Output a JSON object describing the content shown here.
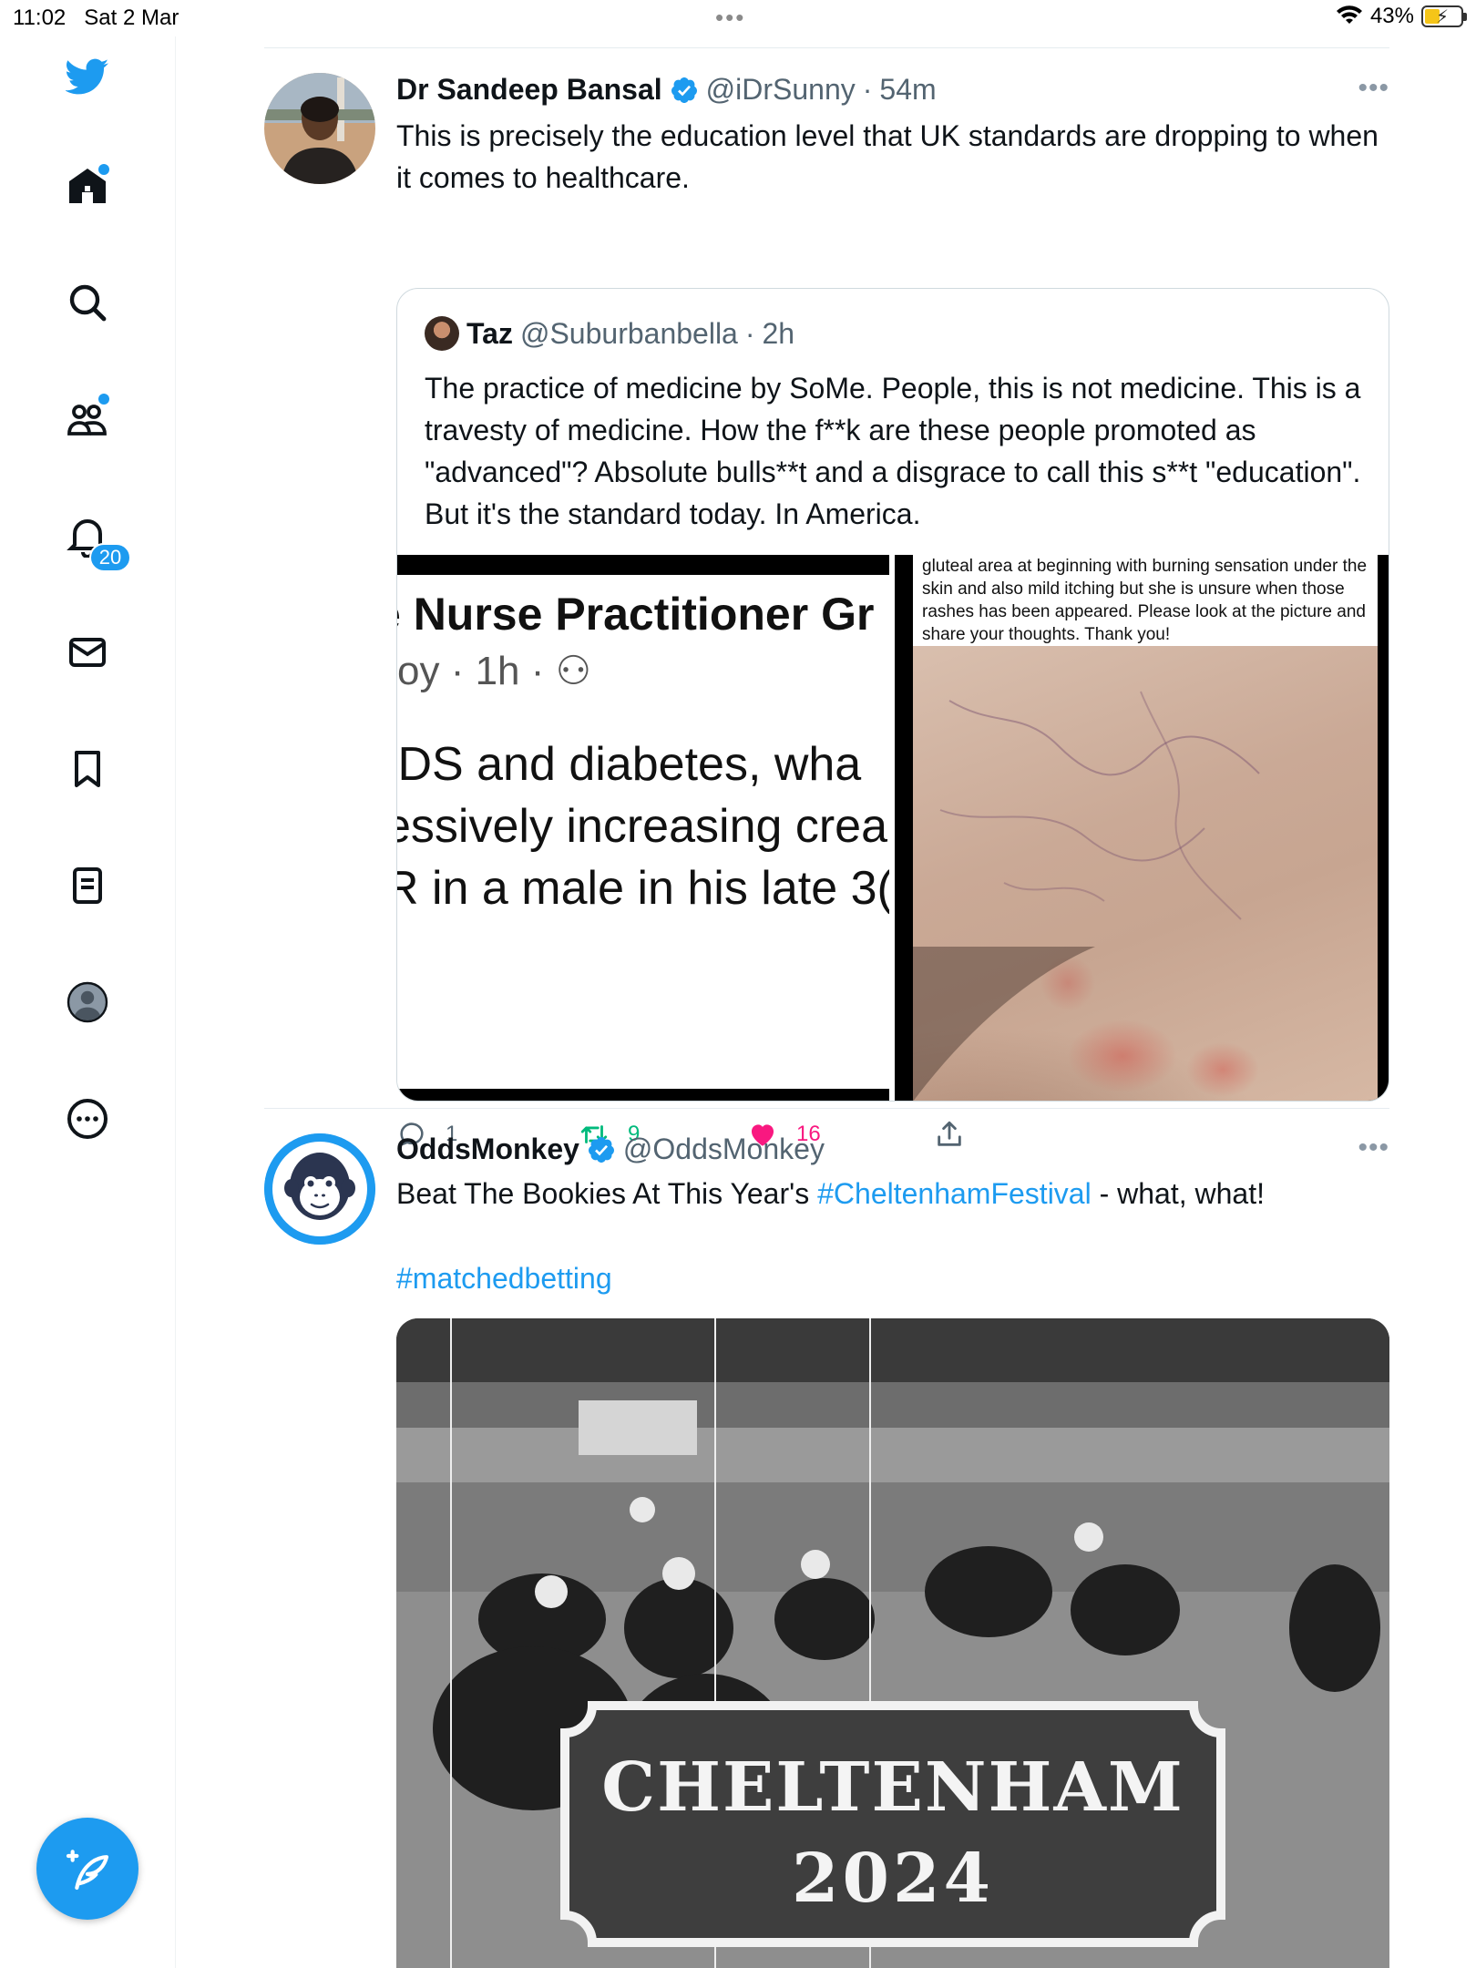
{
  "status_bar": {
    "time": "11:02",
    "date": "Sat 2 Mar",
    "battery": "43%",
    "battery_level": 0.43
  },
  "sidebar": {
    "items": [
      {
        "name": "twitter-logo",
        "icon": "bird-icon"
      },
      {
        "name": "home",
        "icon": "home-icon",
        "has_dot": true
      },
      {
        "name": "explore",
        "icon": "search-icon"
      },
      {
        "name": "communities",
        "icon": "people-icon",
        "has_dot": true
      },
      {
        "name": "notifications",
        "icon": "bell-icon",
        "badge": "20"
      },
      {
        "name": "messages",
        "icon": "mail-icon"
      },
      {
        "name": "bookmarks",
        "icon": "bookmark-icon"
      },
      {
        "name": "lists",
        "icon": "list-icon"
      },
      {
        "name": "profile",
        "icon": "profile-avatar-icon"
      },
      {
        "name": "more",
        "icon": "more-circle-icon"
      }
    ],
    "notifications_badge": "20",
    "compose_icon": "compose-feather-icon"
  },
  "colors": {
    "accent": "#1d9bf0",
    "like": "#f91880",
    "retweet": "#00ba7c",
    "text": "#0f1419",
    "muted": "#536471"
  },
  "tweets": [
    {
      "author": "Dr Sandeep Bansal",
      "handle": "@iDrSunny",
      "separator": "·",
      "time": "54m",
      "verified": true,
      "more": "•••",
      "text": "This is precisely the education level that UK standards are dropping to when it comes to healthcare.",
      "quote": {
        "author": "Taz",
        "handle": "@Suburbanbella",
        "separator": "·",
        "time": "2h",
        "text": "The practice of medicine by SoMe. People, this is not medicine. This is a travesty of medicine. How the f**k are these people promoted as \"advanced\"? Absolute bulls**t and a disgrace to call this s**t \"education\". But it's the standard today. In America.",
        "image_left": {
          "title": "e Nurse Practitioner Gr",
          "meta": "oy · 1h · ⚇",
          "lines": [
            "IDS and diabetes, wha",
            "essively increasing crea",
            "R in a male in his late 3("
          ]
        },
        "image_right": {
          "caption": "gluteal area at beginning with burning sensation under the skin and also mild itching but she is unsure when those rashes has been appeared. Please look at the picture and share your thoughts. Thank you!"
        }
      },
      "actions": {
        "replies": "1",
        "retweets": "9",
        "likes": "16",
        "liked": true
      }
    },
    {
      "author": "OddsMonkey",
      "handle": "@OddsMonkey",
      "verified": true,
      "more": "•••",
      "text_before": "Beat The Bookies At This Year's ",
      "hashtag1": "#CheltenhamFestival",
      "text_after": " - what, what!",
      "hashtag2": "#matchedbetting",
      "media": {
        "banner_line1": "CHELTENHAM",
        "banner_line2": "2024"
      }
    }
  ]
}
